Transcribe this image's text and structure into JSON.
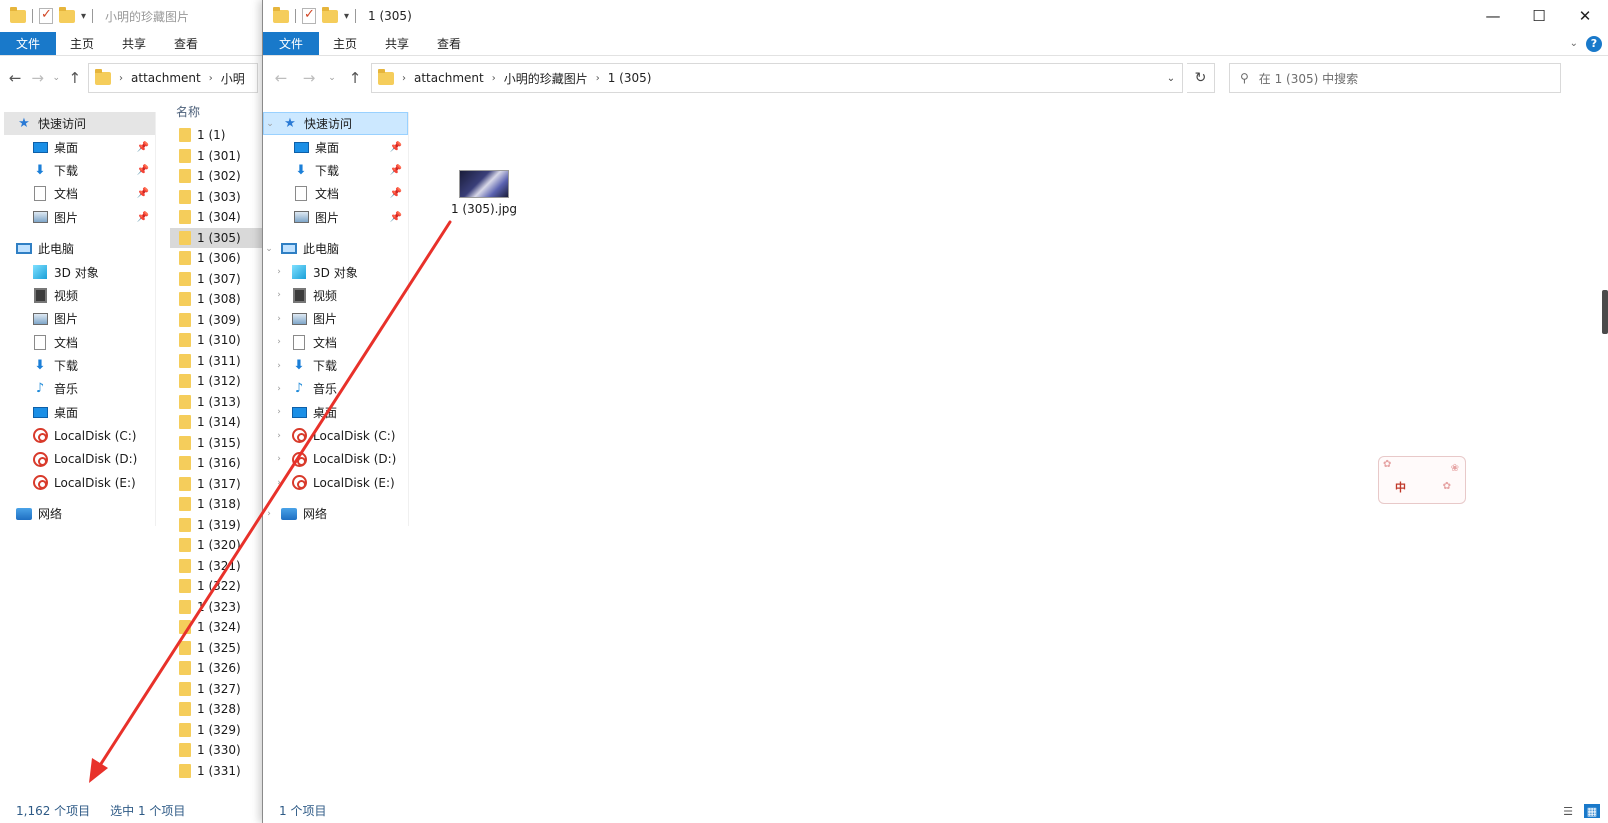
{
  "back": {
    "title": "小明的珍藏图片",
    "tabs": [
      "文件",
      "主页",
      "共享",
      "查看"
    ],
    "breadcrumb": [
      "attachment",
      "小明"
    ],
    "column_header": "名称",
    "nav": {
      "quick_access": "快速访问",
      "desktop": "桌面",
      "downloads": "下载",
      "documents": "文档",
      "pictures": "图片",
      "this_pc": "此电脑",
      "objects3d": "3D 对象",
      "videos": "视频",
      "pictures2": "图片",
      "documents2": "文档",
      "downloads2": "下载",
      "music": "音乐",
      "desktop2": "桌面",
      "disk_c": "LocalDisk (C:)",
      "disk_d": "LocalDisk (D:)",
      "disk_e": "LocalDisk (E:)",
      "network": "网络"
    },
    "folders": [
      "1 (1)",
      "1 (301)",
      "1 (302)",
      "1 (303)",
      "1 (304)",
      "1 (305)",
      "1 (306)",
      "1 (307)",
      "1 (308)",
      "1 (309)",
      "1 (310)",
      "1 (311)",
      "1 (312)",
      "1 (313)",
      "1 (314)",
      "1 (315)",
      "1 (316)",
      "1 (317)",
      "1 (318)",
      "1 (319)",
      "1 (320)",
      "1 (321)",
      "1 (322)",
      "1 (323)",
      "1 (324)",
      "1 (325)",
      "1 (326)",
      "1 (327)",
      "1 (328)",
      "1 (329)",
      "1 (330)",
      "1 (331)"
    ],
    "selected_folder": "1 (305)",
    "status_count": "1,162 个项目",
    "status_selected": "选中 1 个项目"
  },
  "front": {
    "title": "1 (305)",
    "tabs": [
      "文件",
      "主页",
      "共享",
      "查看"
    ],
    "breadcrumb": [
      "attachment",
      "小明的珍藏图片",
      "1 (305)"
    ],
    "search_placeholder": "在 1 (305) 中搜索",
    "nav": {
      "quick_access": "快速访问",
      "desktop": "桌面",
      "downloads": "下载",
      "documents": "文档",
      "pictures": "图片",
      "this_pc": "此电脑",
      "objects3d": "3D 对象",
      "videos": "视频",
      "pictures2": "图片",
      "documents2": "文档",
      "downloads2": "下载",
      "music": "音乐",
      "desktop2": "桌面",
      "disk_c": "LocalDisk (C:)",
      "disk_d": "LocalDisk (D:)",
      "disk_e": "LocalDisk (E:)",
      "network": "网络"
    },
    "file": "1 (305).jpg",
    "status_count": "1 个项目",
    "window_controls": [
      "—",
      "☐",
      "✕"
    ]
  },
  "ime_char": "中",
  "annotation_color": "#e8312a"
}
